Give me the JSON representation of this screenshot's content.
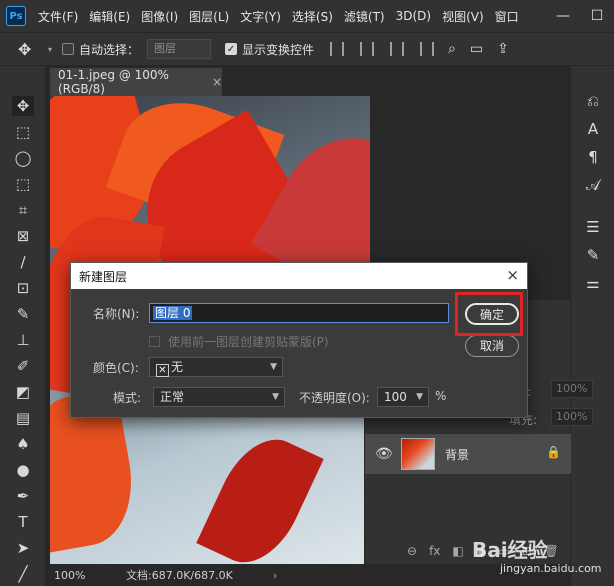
{
  "app": {
    "logo": "Ps"
  },
  "menu": [
    "文件(F)",
    "编辑(E)",
    "图像(I)",
    "图层(L)",
    "文字(Y)",
    "选择(S)",
    "滤镜(T)",
    "3D(D)",
    "视图(V)",
    "窗口"
  ],
  "window_controls": {
    "minimize": "—",
    "maximize": "☐"
  },
  "options": {
    "auto_select_label": "自动选择：",
    "auto_select_value": "图层",
    "show_transform_label": "显示变换控件"
  },
  "document": {
    "tab_title": "01-1.jpeg @ 100%(RGB/8)",
    "tab_close": "×",
    "zoom": "100%",
    "doc_info": "文档:687.0K/687.0K"
  },
  "layers_panel": {
    "opacity_label": "度:",
    "opacity_value": "100%",
    "fill_label": "填充:",
    "fill_value": "100%",
    "layer_name": "背景",
    "bottom_icons": [
      "⊖",
      "fx",
      "◧",
      "◉",
      "▭",
      "⊞",
      "🗑"
    ]
  },
  "dialog": {
    "title": "新建图层",
    "close": "×",
    "name_label": "名称(N):",
    "name_value": "图层 0",
    "clip_label": "使用前一图层创建剪贴蒙版(P)",
    "color_label": "颜色(C):",
    "color_value": "无",
    "mode_label": "模式:",
    "mode_value": "正常",
    "opacity_label": "不透明度(O):",
    "opacity_value": "100",
    "opacity_unit": "%",
    "ok_label": "确定",
    "cancel_label": "取消"
  },
  "watermark": {
    "text": "Bai经验",
    "url": "jingyan.baidu.com"
  },
  "colors": {
    "highlight": "#e02424",
    "selection": "#2f6cc4",
    "panel": "#323232"
  }
}
